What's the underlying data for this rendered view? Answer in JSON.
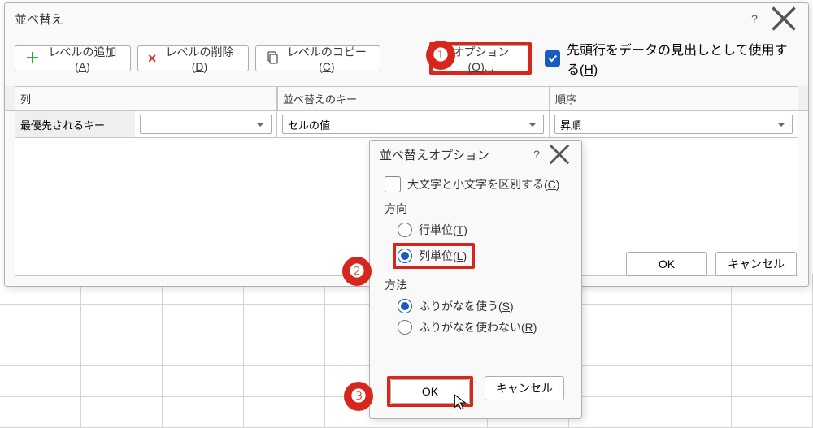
{
  "main_dialog": {
    "title": "並べ替え",
    "toolbar": {
      "add_label_pre": "レベルの追加(",
      "add_key": "A",
      "delete_label_pre": "レベルの削除(",
      "delete_key": "D",
      "copy_label_pre": "レベルのコピー(",
      "copy_key": "C",
      "options_label_pre": "オプション(",
      "options_key": "O",
      "options_suffix": ")...",
      "close_paren": ")",
      "header_row_label_pre": "先頭行をデータの見出しとして使用する(",
      "header_row_key": "H",
      "header_row_checked": true
    },
    "columns": {
      "col_label": "列",
      "key_label": "並べ替えのキー",
      "order_label": "順序"
    },
    "row1": {
      "key_label": "最優先されるキー",
      "column_value": "",
      "sort_on_value": "セルの値",
      "order_value": "昇順"
    },
    "buttons": {
      "ok": "OK",
      "cancel": "キャンセル"
    }
  },
  "options_dialog": {
    "title": "並べ替えオプション",
    "case_label_pre": "大文字と小文字を区別する(",
    "case_key": "C",
    "close_paren": ")",
    "case_checked": false,
    "direction_label": "方向",
    "dir_row_label_pre": "行単位(",
    "dir_row_key": "T",
    "dir_col_label_pre": "列単位(",
    "dir_col_key": "L",
    "method_label": "方法",
    "method_furigana_label_pre": "ふりがなを使う(",
    "method_furigana_key": "S",
    "method_no_furigana_label_pre": "ふりがなを使わない(",
    "method_no_furigana_key": "R",
    "ok": "OK",
    "cancel": "キャンセル"
  },
  "callouts": {
    "n1": "❶",
    "n2": "❷",
    "n3": "❸"
  }
}
